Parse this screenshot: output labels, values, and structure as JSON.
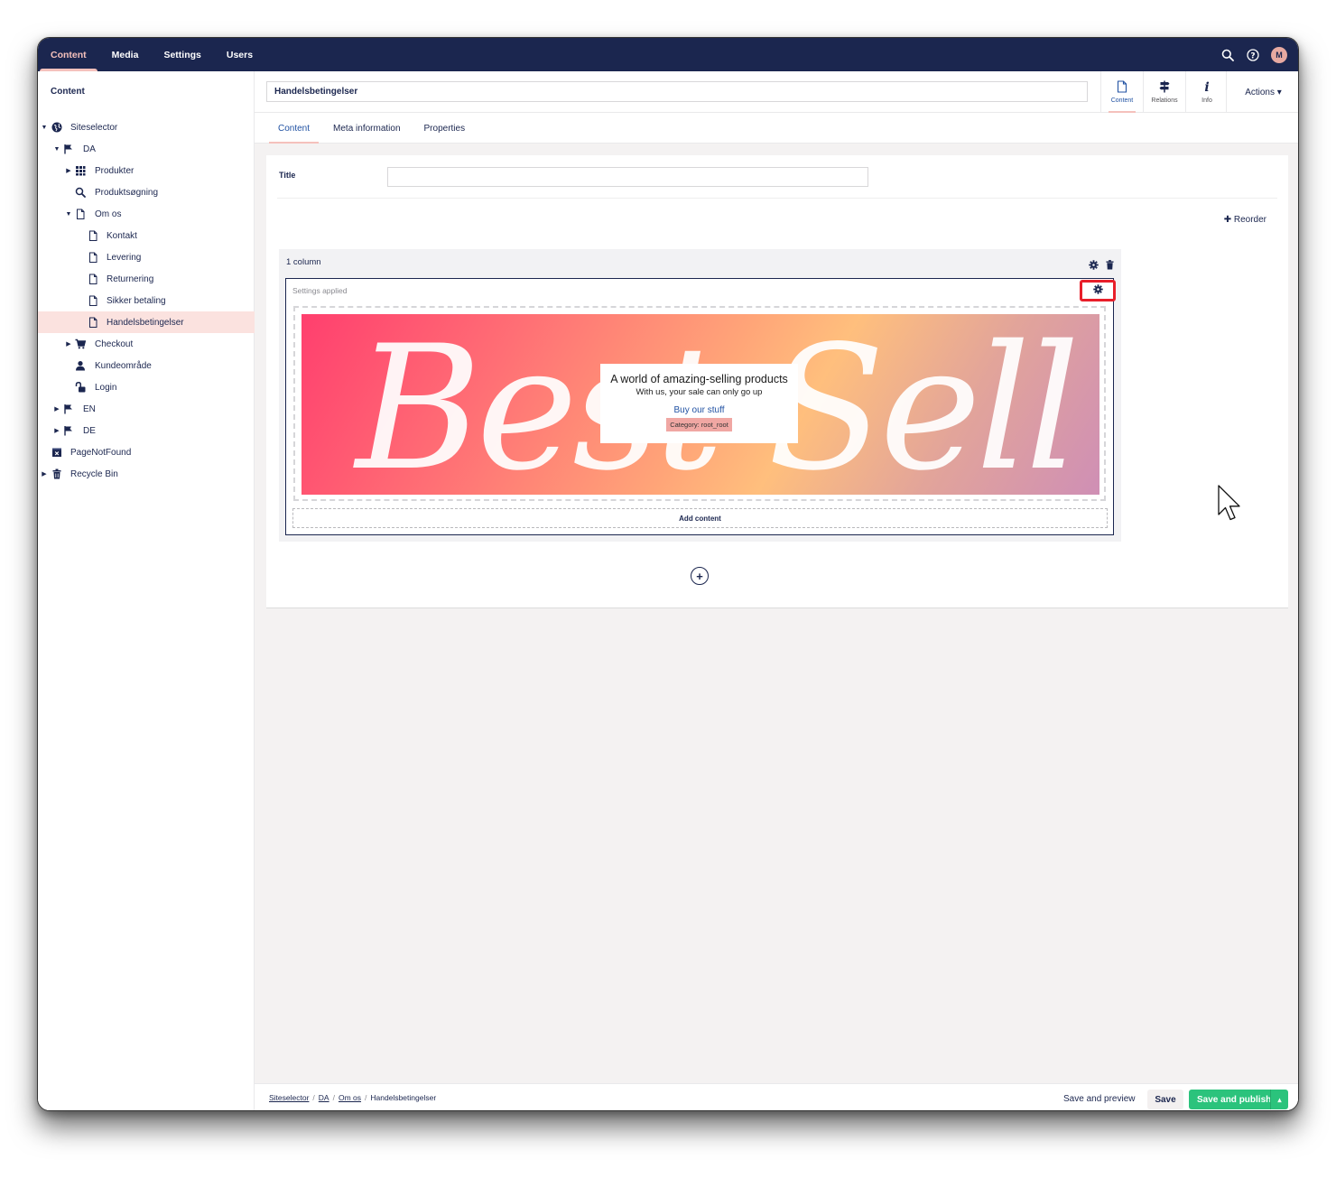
{
  "topnav": {
    "items": [
      {
        "label": "Content",
        "active": true
      },
      {
        "label": "Media",
        "active": false
      },
      {
        "label": "Settings",
        "active": false
      },
      {
        "label": "Users",
        "active": false
      }
    ],
    "avatar_initial": "M"
  },
  "sidebar": {
    "title": "Content",
    "tree": [
      {
        "label": "Siteselector",
        "icon": "globe-icon"
      },
      {
        "label": "DA",
        "icon": "flag-icon"
      },
      {
        "label": "Produkter",
        "icon": "grid-icon"
      },
      {
        "label": "Produktsøgning",
        "icon": "search-icon"
      },
      {
        "label": "Om os",
        "icon": "document-icon"
      },
      {
        "label": "Kontakt",
        "icon": "document-icon"
      },
      {
        "label": "Levering",
        "icon": "document-icon"
      },
      {
        "label": "Returnering",
        "icon": "document-icon"
      },
      {
        "label": "Sikker betaling",
        "icon": "document-icon"
      },
      {
        "label": "Handelsbetingelser",
        "icon": "document-icon",
        "selected": true
      },
      {
        "label": "Checkout",
        "icon": "cart-icon"
      },
      {
        "label": "Kundeområde",
        "icon": "user-icon"
      },
      {
        "label": "Login",
        "icon": "unlock-icon"
      },
      {
        "label": "EN",
        "icon": "flag-icon"
      },
      {
        "label": "DE",
        "icon": "flag-icon"
      },
      {
        "label": "PageNotFound",
        "icon": "error-page-icon"
      },
      {
        "label": "Recycle Bin",
        "icon": "trash-icon"
      }
    ]
  },
  "header": {
    "name_value": "Handelsbetingelser",
    "apps": [
      {
        "label": "Content",
        "icon": "document-icon",
        "active": true
      },
      {
        "label": "Relations",
        "icon": "signpost-icon",
        "active": false
      },
      {
        "label": "Info",
        "icon": "info-icon",
        "active": false
      }
    ],
    "actions_label": "Actions ▾"
  },
  "tabs": [
    {
      "label": "Content",
      "active": true
    },
    {
      "label": "Meta information",
      "active": false
    },
    {
      "label": "Properties",
      "active": false
    }
  ],
  "editor": {
    "title_label": "Title",
    "title_value": "",
    "reorder_label": "Reorder",
    "row_title": "1 column",
    "cell_label": "Settings applied",
    "banner": {
      "script_text": "Best Sellers",
      "heading": "A world of amazing-selling products",
      "subheading": "With us, your sale can only go up",
      "link": "Buy our stuff",
      "tag": "Category: root_root"
    },
    "add_content_label": "Add content",
    "add_row_symbol": "+"
  },
  "footer": {
    "breadcrumb": [
      "Siteselector",
      "DA",
      "Om os",
      "Handelsbetingelser"
    ],
    "save_preview_label": "Save and preview",
    "save_label": "Save",
    "publish_label": "Save and publish",
    "publish_caret": "▴"
  },
  "colors": {
    "topbar": "#1b264f",
    "accent": "#f5c1bc",
    "selected_bg": "#fbe2df",
    "publish_green": "#2bc37c",
    "highlight_red": "#e81f2a"
  }
}
